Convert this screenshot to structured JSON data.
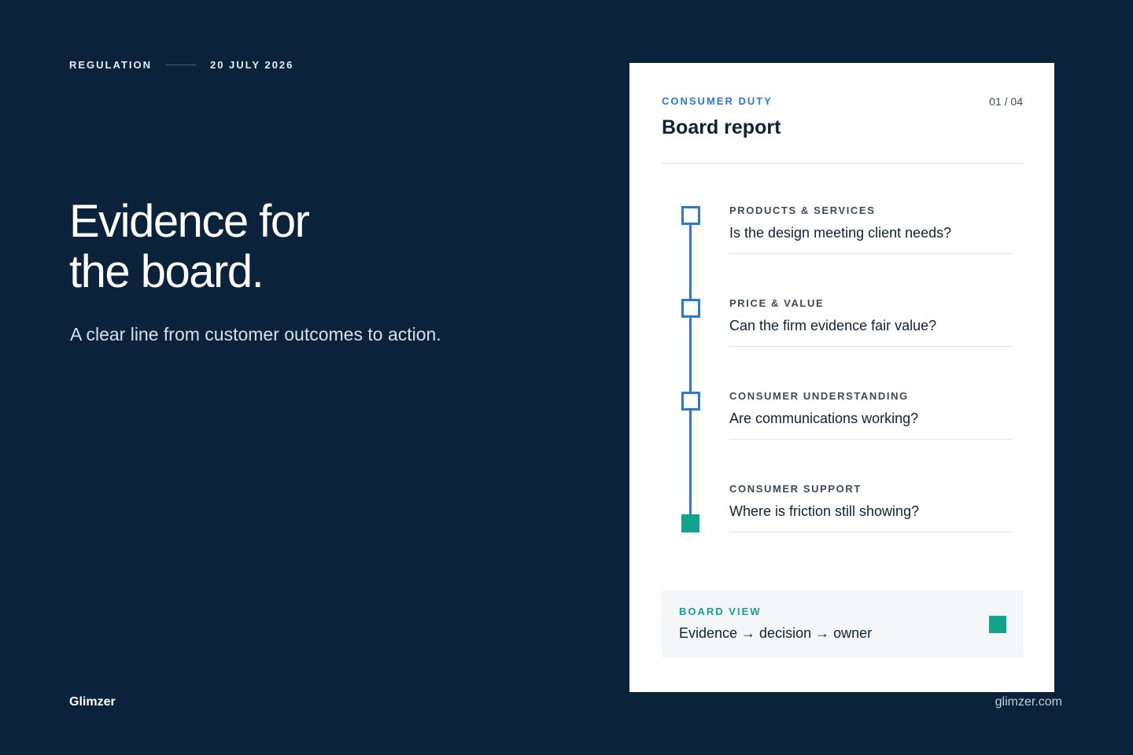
{
  "header": {
    "category": "REGULATION",
    "date": "20 JULY 2026"
  },
  "hero": {
    "headline_line1": "Evidence for",
    "headline_line2": "the board.",
    "subline": "A clear line from customer outcomes to action."
  },
  "footer": {
    "brand": "Glimzer",
    "site": "glimzer.com"
  },
  "card": {
    "eyebrow": "CONSUMER DUTY",
    "title": "Board report",
    "page": "01 / 04",
    "items": [
      {
        "label": "PRODUCTS & SERVICES",
        "question": "Is the design meeting client needs?"
      },
      {
        "label": "PRICE & VALUE",
        "question": "Can the firm evidence fair value?"
      },
      {
        "label": "CONSUMER UNDERSTANDING",
        "question": "Are communications working?"
      },
      {
        "label": "CONSUMER SUPPORT",
        "question": "Where is friction still showing?"
      }
    ],
    "board": {
      "eyebrow": "BOARD VIEW",
      "text": "Evidence → decision → owner"
    }
  },
  "colors": {
    "background": "#0b233a",
    "accent_blue": "#2b7ad0",
    "accent_teal": "#12a38c",
    "card": "#ffffff"
  },
  "icons": {
    "timeline_marker": "square-outline-icon",
    "timeline_end": "square-filled-icon",
    "board_marker": "square-filled-icon"
  }
}
